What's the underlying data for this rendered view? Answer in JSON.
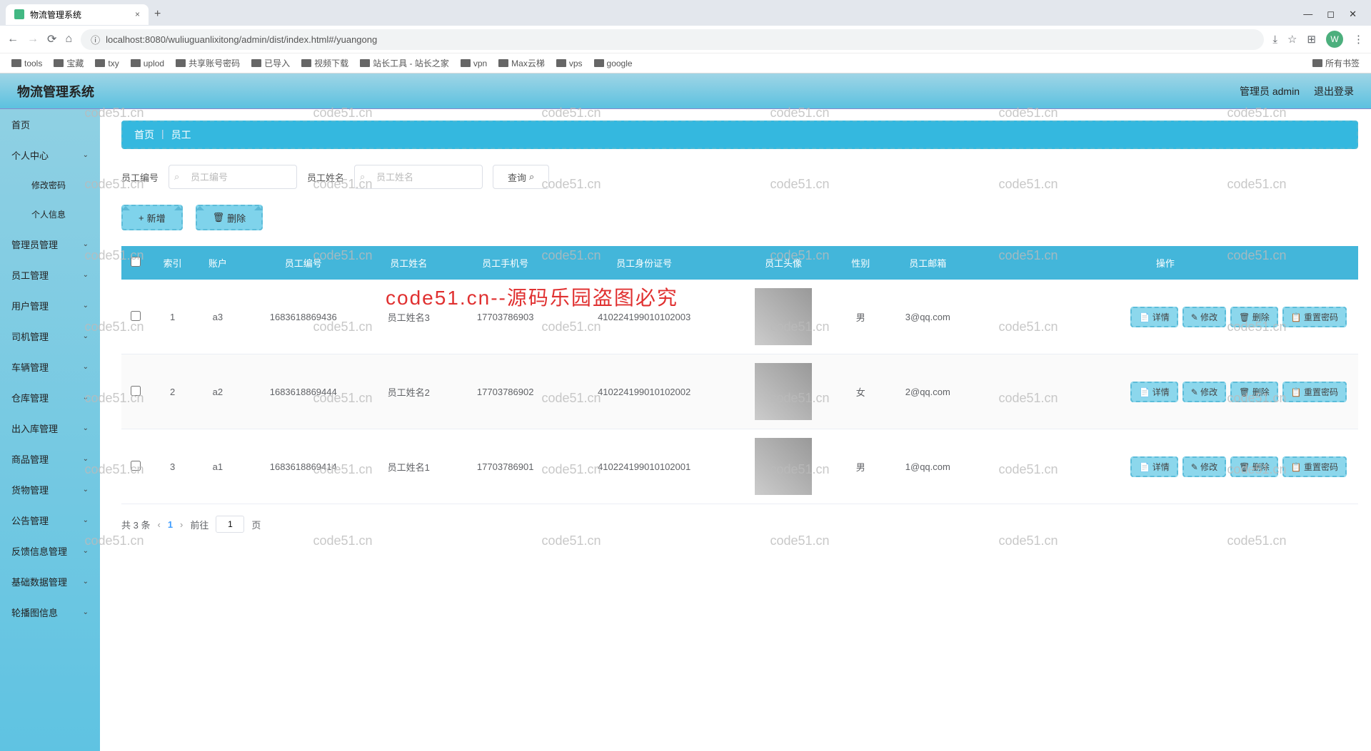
{
  "browser": {
    "tab_title": "物流管理系统",
    "url": "localhost:8080/wuliuguanlixitong/admin/dist/index.html#/yuangong",
    "bookmarks": [
      "tools",
      "宝藏",
      "txy",
      "uplod",
      "共享账号密码",
      "已导入",
      "视频下载",
      "站长工具 - 站长之家",
      "vpn",
      "Max云梯",
      "vps",
      "google"
    ],
    "bookmark_right": "所有书签",
    "profile_letter": "W"
  },
  "header": {
    "title": "物流管理系统",
    "user_label": "管理员 admin",
    "logout": "退出登录"
  },
  "sidebar": {
    "items": [
      {
        "label": "首页",
        "chev": false
      },
      {
        "label": "个人中心",
        "chev": true
      },
      {
        "label": "修改密码",
        "sub": true
      },
      {
        "label": "个人信息",
        "sub": true
      },
      {
        "label": "管理员管理",
        "chev": true
      },
      {
        "label": "员工管理",
        "chev": true
      },
      {
        "label": "用户管理",
        "chev": true
      },
      {
        "label": "司机管理",
        "chev": true
      },
      {
        "label": "车辆管理",
        "chev": true
      },
      {
        "label": "仓库管理",
        "chev": true
      },
      {
        "label": "出入库管理",
        "chev": true
      },
      {
        "label": "商品管理",
        "chev": true
      },
      {
        "label": "货物管理",
        "chev": true
      },
      {
        "label": "公告管理",
        "chev": true
      },
      {
        "label": "反馈信息管理",
        "chev": true
      },
      {
        "label": "基础数据管理",
        "chev": true
      },
      {
        "label": "轮播图信息",
        "chev": true
      }
    ]
  },
  "breadcrumb": {
    "home": "首页",
    "current": "员工"
  },
  "search": {
    "label1": "员工编号",
    "ph1": "员工编号",
    "label2": "员工姓名",
    "ph2": "员工姓名",
    "btn": "查询"
  },
  "toolbar": {
    "add": "新增",
    "del": "删除"
  },
  "table": {
    "headers": [
      "索引",
      "账户",
      "员工编号",
      "员工姓名",
      "员工手机号",
      "员工身份证号",
      "员工头像",
      "性别",
      "员工邮箱",
      "操作"
    ],
    "ops": {
      "detail": "详情",
      "edit": "修改",
      "del": "删除",
      "reset": "重置密码"
    },
    "rows": [
      {
        "idx": "1",
        "account": "a3",
        "emp_no": "1683618869436",
        "name": "员工姓名3",
        "phone": "17703786903",
        "idcard": "410224199010102003",
        "gender": "男",
        "email": "3@qq.com"
      },
      {
        "idx": "2",
        "account": "a2",
        "emp_no": "1683618869444",
        "name": "员工姓名2",
        "phone": "17703786902",
        "idcard": "410224199010102002",
        "gender": "女",
        "email": "2@qq.com"
      },
      {
        "idx": "3",
        "account": "a1",
        "emp_no": "1683618869414",
        "name": "员工姓名1",
        "phone": "17703786901",
        "idcard": "410224199010102001",
        "gender": "男",
        "email": "1@qq.com"
      }
    ]
  },
  "pager": {
    "total": "共 3 条",
    "current": "1",
    "goto_pre": "前往",
    "goto_suf": "页",
    "goto_val": "1"
  },
  "watermark": {
    "text": "code51.cn",
    "red": "code51.cn--源码乐园盗图必究"
  }
}
